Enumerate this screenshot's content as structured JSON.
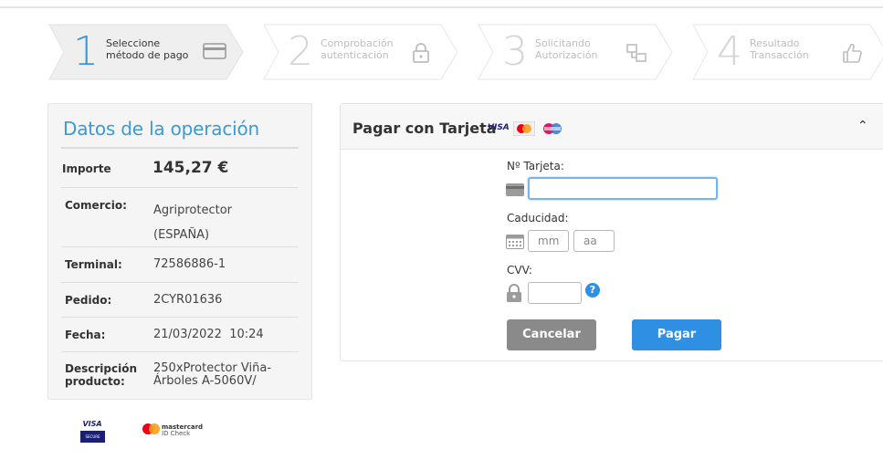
{
  "steps": [
    {
      "number": "1",
      "line1": "Seleccione",
      "line2": "método de pago",
      "icon": "credit-card-icon",
      "active": true
    },
    {
      "number": "2",
      "line1": "Comprobación",
      "line2": "autenticación",
      "icon": "lock-icon",
      "active": false
    },
    {
      "number": "3",
      "line1": "Solicitando",
      "line2": "Autorización",
      "icon": "exchange-icon",
      "active": false
    },
    {
      "number": "4",
      "line1": "Resultado",
      "line2": "Transacción",
      "icon": "thumbs-up-icon",
      "active": false
    }
  ],
  "operation": {
    "title": "Datos de la operación",
    "amount_label": "Importe",
    "amount_value": "145,27 €",
    "merchant_label": "Comercio:",
    "merchant_line1": "Agriprotector",
    "merchant_line2": "(ESPAÑA)",
    "terminal_label": "Terminal:",
    "terminal_value": "72586886-1",
    "order_label": "Pedido:",
    "order_value": "2CYR01636",
    "date_label": "Fecha:",
    "date_value": "21/03/2022  10:24",
    "desc_label_line1": "Descripción",
    "desc_label_line2": "producto:",
    "desc_line1": "250xProtector Viña-",
    "desc_line2": "Árboles A-5060V/"
  },
  "secure_logos": {
    "visa_top": "VISA",
    "visa_bottom": "SECURE",
    "mc_line1": "mastercard",
    "mc_line2": "ID Check"
  },
  "card_form": {
    "title": "Pagar con Tarjeta",
    "brand_visa": "VISA",
    "card_number_label": "Nº Tarjeta:",
    "card_number_value": "",
    "expiry_label": "Caducidad:",
    "month_placeholder": "mm",
    "year_placeholder": "aa",
    "cvv_label": "CVV:",
    "help_symbol": "?",
    "cancel_label": "Cancelar",
    "pay_label": "Pagar",
    "collapse_symbol": "⌃"
  },
  "colors": {
    "accent": "#3a9ad9",
    "pay_button": "#2f8fe3",
    "cancel_button": "#8a8a8a",
    "step_inactive": "#d5d5d5"
  }
}
